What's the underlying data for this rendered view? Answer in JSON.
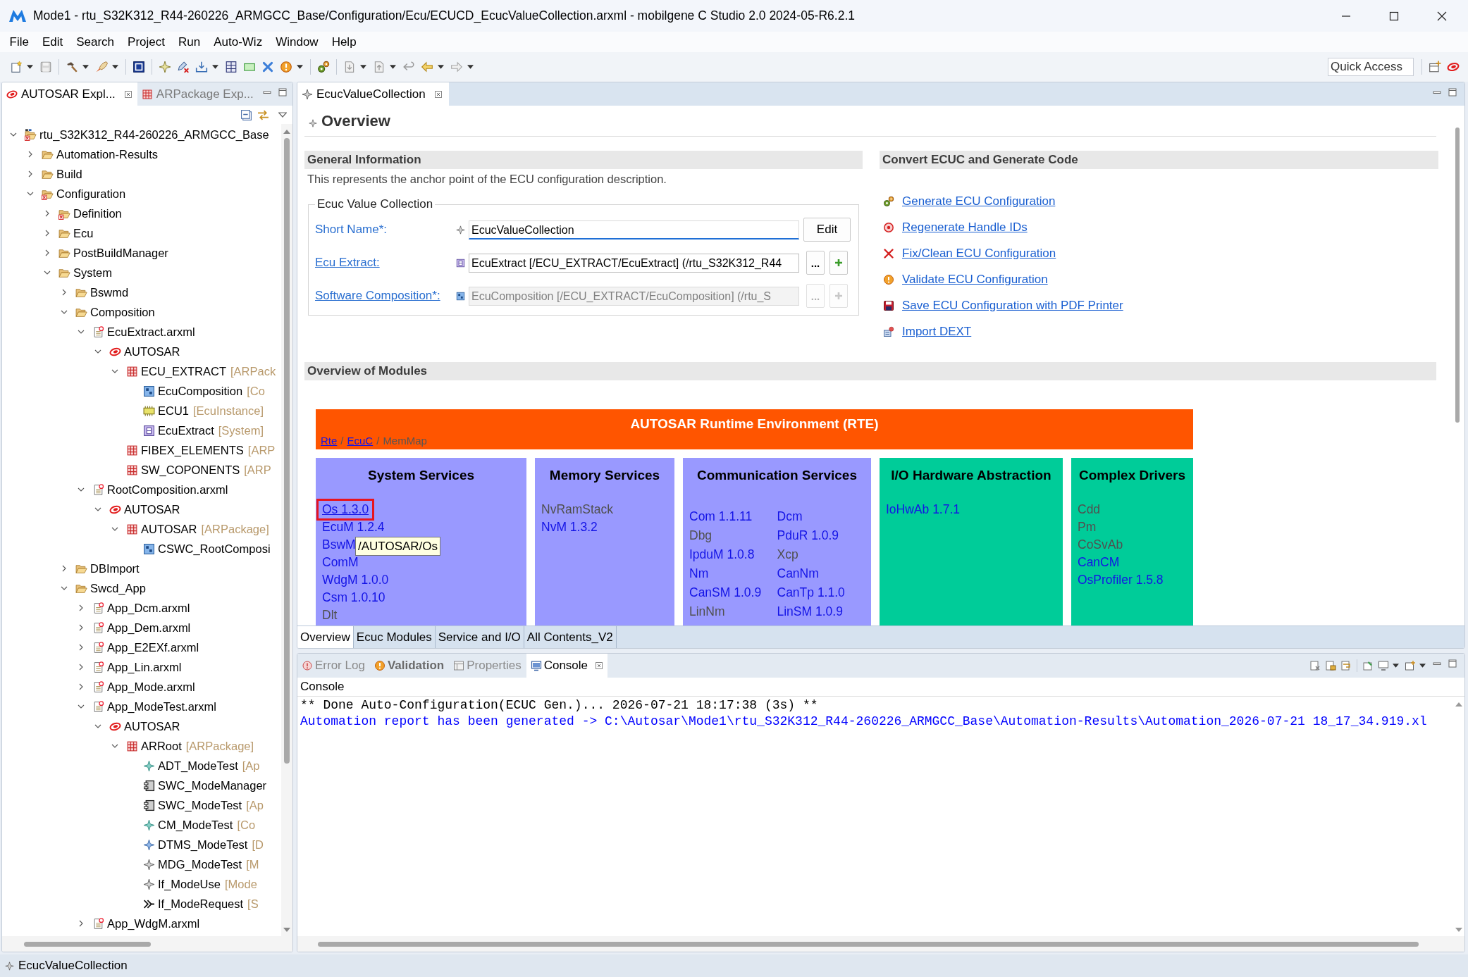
{
  "window": {
    "title": "Mode1 - rtu_S32K312_R44-260226_ARMGCC_Base/Configuration/Ecu/ECUCD_EcucValueCollection.arxml - mobilgene C Studio 2.0 2024-05-R6.2.1"
  },
  "menu": [
    "File",
    "Edit",
    "Search",
    "Project",
    "Run",
    "Auto-Wiz",
    "Window",
    "Help"
  ],
  "toolbar": {
    "quick_access": {
      "placeholder": "Quick Access"
    }
  },
  "explorer": {
    "tabs": [
      {
        "label": "AUTOSAR Expl...",
        "kind": "autosar",
        "selected": true
      },
      {
        "label": "ARPackage Exp...",
        "kind": "package",
        "selected": false
      }
    ],
    "tree": [
      {
        "label": "rtu_S32K312_R44-260226_ARMGCC_Base",
        "kind": "project",
        "expanded": true,
        "children": [
          {
            "label": "Automation-Results",
            "kind": "folder",
            "expanded": false
          },
          {
            "label": "Build",
            "kind": "folder",
            "expanded": false
          },
          {
            "label": "Configuration",
            "kind": "folder_error",
            "expanded": true,
            "children": [
              {
                "label": "Definition",
                "kind": "folder_error",
                "expanded": false
              },
              {
                "label": "Ecu",
                "kind": "folder",
                "expanded": false
              },
              {
                "label": "PostBuildManager",
                "kind": "folder",
                "expanded": false
              },
              {
                "label": "System",
                "kind": "folder",
                "expanded": true,
                "children": [
                  {
                    "label": "Bswmd",
                    "kind": "folder",
                    "expanded": false
                  },
                  {
                    "label": "Composition",
                    "kind": "folder",
                    "expanded": true,
                    "children": [
                      {
                        "label": "EcuExtract.arxml",
                        "kind": "file",
                        "expanded": true,
                        "children": [
                          {
                            "label": "AUTOSAR",
                            "kind": "autosar",
                            "expanded": true,
                            "children": [
                              {
                                "label": "ECU_EXTRACT",
                                "type": "[ARPack",
                                "kind": "package",
                                "expanded": true,
                                "children": [
                                  {
                                    "label": "EcuComposition",
                                    "type": "[Co",
                                    "kind": "composition"
                                  },
                                  {
                                    "label": "ECU1",
                                    "type": "[EcuInstance]",
                                    "kind": "ecu"
                                  },
                                  {
                                    "label": "EcuExtract",
                                    "type": "[System]",
                                    "kind": "system"
                                  }
                                ]
                              },
                              {
                                "label": "FIBEX_ELEMENTS",
                                "type": "[ARP",
                                "kind": "package"
                              },
                              {
                                "label": "SW_COPONENTS",
                                "type": "[ARP",
                                "kind": "package"
                              }
                            ]
                          }
                        ]
                      },
                      {
                        "label": "RootComposition.arxml",
                        "kind": "file",
                        "expanded": true,
                        "children": [
                          {
                            "label": "AUTOSAR",
                            "kind": "autosar",
                            "expanded": true,
                            "children": [
                              {
                                "label": "AUTOSAR",
                                "type": "[ARPackage]",
                                "kind": "package",
                                "expanded": true,
                                "children": [
                                  {
                                    "label": "CSWC_RootComposi",
                                    "kind": "composition"
                                  }
                                ]
                              }
                            ]
                          }
                        ]
                      }
                    ]
                  },
                  {
                    "label": "DBImport",
                    "kind": "folder",
                    "expanded": false
                  },
                  {
                    "label": "Swcd_App",
                    "kind": "folder",
                    "expanded": true,
                    "children": [
                      {
                        "label": "App_Dcm.arxml",
                        "kind": "file",
                        "expanded": false
                      },
                      {
                        "label": "App_Dem.arxml",
                        "kind": "file",
                        "expanded": false
                      },
                      {
                        "label": "App_E2EXf.arxml",
                        "kind": "file",
                        "expanded": false
                      },
                      {
                        "label": "App_Lin.arxml",
                        "kind": "file",
                        "expanded": false
                      },
                      {
                        "label": "App_Mode.arxml",
                        "kind": "file",
                        "expanded": false
                      },
                      {
                        "label": "App_ModeTest.arxml",
                        "kind": "file",
                        "expanded": true,
                        "children": [
                          {
                            "label": "AUTOSAR",
                            "kind": "autosar",
                            "expanded": true,
                            "children": [
                              {
                                "label": "ARRoot",
                                "type": "[ARPackage]",
                                "kind": "package",
                                "expanded": true,
                                "children": [
                                  {
                                    "label": "ADT_ModeTest",
                                    "type": "[Ap",
                                    "kind": "element"
                                  },
                                  {
                                    "label": "SWC_ModeManager",
                                    "kind": "swc"
                                  },
                                  {
                                    "label": "SWC_ModeTest",
                                    "type": "[Ap",
                                    "kind": "swc"
                                  },
                                  {
                                    "label": "CM_ModeTest",
                                    "type": "[Co",
                                    "kind": "element"
                                  },
                                  {
                                    "label": "DTMS_ModeTest",
                                    "type": "[D",
                                    "kind": "element_blue"
                                  },
                                  {
                                    "label": "MDG_ModeTest",
                                    "type": "[M",
                                    "kind": "element_gray"
                                  },
                                  {
                                    "label": "If_ModeUse",
                                    "type": "[Mode",
                                    "kind": "element_gray"
                                  },
                                  {
                                    "label": "If_ModeRequest",
                                    "type": "[S",
                                    "kind": "interface"
                                  }
                                ]
                              }
                            ]
                          }
                        ]
                      },
                      {
                        "label": "App_WdgM.arxml",
                        "kind": "file",
                        "expanded": false
                      }
                    ]
                  }
                ]
              }
            ]
          }
        ]
      }
    ]
  },
  "editor": {
    "tab": {
      "label": "EcucValueCollection"
    },
    "heading": "Overview",
    "general": {
      "title": "General Information",
      "description": "This represents the anchor point of the ECU configuration description.",
      "group": {
        "title": "Ecuc Value Collection",
        "fields": [
          {
            "kind": "name",
            "label": "Short Name*:",
            "link": false,
            "value": "EcucValueCollection",
            "focused": true,
            "disabled": false,
            "button": "Edit"
          },
          {
            "kind": "system",
            "label": "Ecu Extract:",
            "link": true,
            "value": "EcuExtract [/ECU_EXTRACT/EcuExtract] (/rtu_S32K312_R44",
            "focused": false,
            "disabled": false,
            "button": "..."
          },
          {
            "kind": "composition",
            "label": "Software Composition*:",
            "link": true,
            "value": "EcuComposition [/ECU_EXTRACT/EcuComposition] (/rtu_S",
            "focused": false,
            "disabled": true,
            "button": "..."
          }
        ]
      }
    },
    "convert": {
      "title": "Convert ECUC and Generate Code",
      "actions": [
        {
          "kind": "generate",
          "label": "Generate ECU Configuration"
        },
        {
          "kind": "regenerate",
          "label": "Regenerate Handle IDs"
        },
        {
          "kind": "fix",
          "label": "Fix/Clean ECU Configuration"
        },
        {
          "kind": "validate",
          "label": "Validate ECU Configuration"
        },
        {
          "kind": "save",
          "label": "Save ECU Configuration with PDF Printer"
        },
        {
          "kind": "import",
          "label": "Import DEXT"
        }
      ]
    },
    "modules": {
      "title": "Overview of Modules",
      "tooltip": "/AUTOSAR/Os",
      "rte": {
        "title": "AUTOSAR Runtime Environment (RTE)",
        "separator": "/",
        "links": [
          {
            "label": "Rte",
            "linked": true
          },
          {
            "label": "EcuC",
            "linked": true
          },
          {
            "label": "MemMap",
            "linked": false
          }
        ]
      },
      "groups": [
        {
          "title": "System Services",
          "color": "#9999ff",
          "kind": "list",
          "items": [
            {
              "label": "Os 1.3.0",
              "linked": true,
              "hovered": true
            },
            {
              "label": "EcuM 1.2.4",
              "linked": true,
              "hovered": false
            },
            {
              "label": "BswM",
              "linked": true,
              "hovered": false
            },
            {
              "label": "ComM",
              "linked": true,
              "hovered": false
            },
            {
              "label": "WdgM 1.0.0",
              "linked": true,
              "hovered": false
            },
            {
              "label": "Csm 1.0.10",
              "linked": true,
              "hovered": false
            },
            {
              "label": "Dlt",
              "linked": false,
              "hovered": false
            }
          ]
        },
        {
          "title": "Memory Services",
          "color": "#9999ff",
          "kind": "list",
          "items": [
            {
              "label": "NvRamStack",
              "linked": false,
              "hovered": false
            },
            {
              "label": "NvM 1.3.2",
              "linked": true,
              "hovered": false
            }
          ]
        },
        {
          "title": "Communication Services",
          "color": "#9999ff",
          "kind": "grid",
          "items": [
            {
              "label": "Com 1.1.11",
              "linked": true,
              "hovered": false
            },
            {
              "label": "Dcm",
              "linked": true,
              "hovered": false
            },
            {
              "label": "Dbg",
              "linked": false,
              "hovered": false
            },
            {
              "label": "PduR 1.0.9",
              "linked": true,
              "hovered": false
            },
            {
              "label": "IpduM 1.0.8",
              "linked": true,
              "hovered": false
            },
            {
              "label": "Xcp",
              "linked": false,
              "hovered": false
            },
            {
              "label": "Nm",
              "linked": true,
              "hovered": false
            },
            {
              "label": "CanNm",
              "linked": true,
              "hovered": false
            },
            {
              "label": "CanSM 1.0.9",
              "linked": true,
              "hovered": false
            },
            {
              "label": "CanTp 1.1.0",
              "linked": true,
              "hovered": false
            },
            {
              "label": "LinNm",
              "linked": false,
              "hovered": false
            },
            {
              "label": "LinSM 1.0.9",
              "linked": true,
              "hovered": false
            }
          ]
        },
        {
          "title": "I/O Hardware Abstraction",
          "color": "#00cc99",
          "kind": "list",
          "items": [
            {
              "label": "IoHwAb 1.7.1",
              "linked": true,
              "hovered": false
            }
          ]
        },
        {
          "title": "Complex Drivers",
          "color": "#00cc99",
          "kind": "list",
          "items": [
            {
              "label": "Cdd",
              "linked": false,
              "hovered": false
            },
            {
              "label": "Pm",
              "linked": false,
              "hovered": false
            },
            {
              "label": "CoSvAb",
              "linked": false,
              "hovered": false
            },
            {
              "label": "CanCM",
              "linked": true,
              "hovered": false
            },
            {
              "label": "OsProfiler 1.5.8",
              "linked": true,
              "hovered": false
            }
          ]
        }
      ]
    },
    "page_tabs": [
      {
        "label": "Overview",
        "selected": true
      },
      {
        "label": "Ecuc Modules",
        "selected": false
      },
      {
        "label": "Service and I/O",
        "selected": false
      },
      {
        "label": "All Contents_V2",
        "selected": false
      }
    ]
  },
  "bottom_panel": {
    "tabs": [
      {
        "label": "Error Log",
        "kind": "error_log",
        "selected": false,
        "updated": false
      },
      {
        "label": "Validation",
        "kind": "validation",
        "selected": false,
        "updated": true
      },
      {
        "label": "Properties",
        "kind": "properties",
        "selected": false,
        "updated": false
      },
      {
        "label": "Console",
        "kind": "console",
        "selected": true,
        "updated": false
      }
    ],
    "console": {
      "title": "Console",
      "lines": [
        {
          "kind": "output",
          "text": "** Done Auto-Configuration(ECUC Gen.)... 2026-07-21 18:17:38 (3s) **"
        },
        {
          "kind": "info",
          "text": "Automation report has been generated -> C:\\Autosar\\Mode1\\rtu_S32K312_R44-260226_ARMGCC_Base\\Automation-Results\\Automation_2026-07-21 18_17_34.919.xl"
        }
      ]
    }
  },
  "status_bar": {
    "text": "EcucValueCollection"
  }
}
